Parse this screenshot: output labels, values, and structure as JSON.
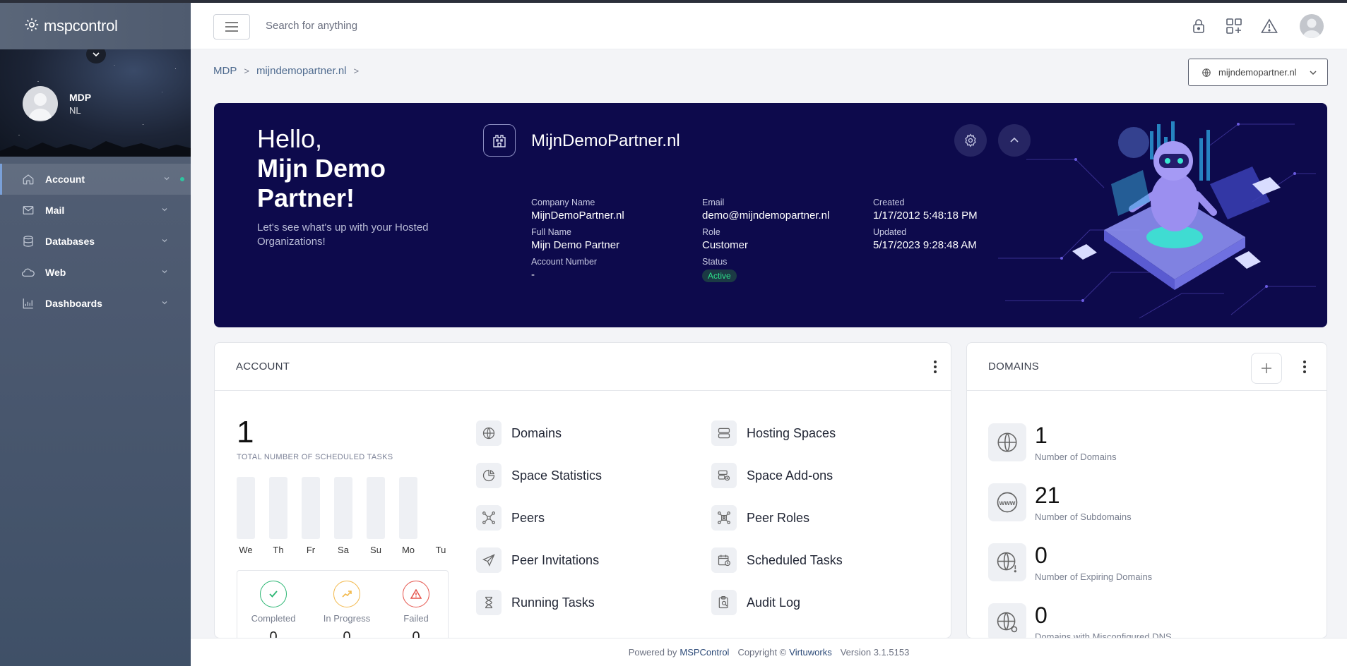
{
  "brand": {
    "name": "mspcontrol",
    "logo_icon": "gear-logo-icon"
  },
  "profile": {
    "name": "MDP",
    "subtitle": "NL"
  },
  "sidebar": {
    "items": [
      {
        "label": "Account",
        "icon": "home-icon",
        "active": true
      },
      {
        "label": "Mail",
        "icon": "mail-icon"
      },
      {
        "label": "Databases",
        "icon": "database-icon"
      },
      {
        "label": "Web",
        "icon": "cloud-icon"
      },
      {
        "label": "Dashboards",
        "icon": "chart-icon"
      }
    ]
  },
  "topbar": {
    "search_placeholder": "Search for anything",
    "icons": [
      "lock-icon",
      "apps-add-icon",
      "warning-icon",
      "user-avatar"
    ]
  },
  "breadcrumb": {
    "items": [
      "MDP",
      "mijndemopartner.nl"
    ]
  },
  "domain_selector": {
    "value": "mijndemopartner.nl"
  },
  "hero": {
    "greeting": "Hello,",
    "name_line1": "Mijn Demo",
    "name_line2": "Partner!",
    "subtitle": "Let's see what's up with your Hosted Organizations!",
    "org_name": "MijnDemoPartner.nl",
    "fields": {
      "company_name": {
        "label": "Company Name",
        "value": "MijnDemoPartner.nl"
      },
      "email": {
        "label": "Email",
        "value": "demo@mijndemopartner.nl"
      },
      "created": {
        "label": "Created",
        "value": "1/17/2012 5:48:18 PM"
      },
      "full_name": {
        "label": "Full Name",
        "value": "Mijn Demo Partner"
      },
      "role": {
        "label": "Role",
        "value": "Customer"
      },
      "updated": {
        "label": "Updated",
        "value": "5/17/2023 9:28:48 AM"
      },
      "account_number": {
        "label": "Account Number",
        "value": "-"
      },
      "status": {
        "label": "Status",
        "value": "Active"
      }
    }
  },
  "account_card": {
    "title": "ACCOUNT",
    "total_scheduled": "1",
    "total_label": "TOTAL NUMBER OF SCHEDULED TASKS",
    "days": [
      "We",
      "Th",
      "Fr",
      "Sa",
      "Su",
      "Mo",
      "Tu"
    ],
    "status": [
      {
        "label": "Completed",
        "value": "0",
        "color": "#2bb673"
      },
      {
        "label": "In Progress",
        "value": "0",
        "color": "#f2b84b"
      },
      {
        "label": "Failed",
        "value": "0",
        "color": "#e5534b"
      }
    ],
    "links": [
      {
        "label": "Domains",
        "icon": "globe-icon"
      },
      {
        "label": "Hosting Spaces",
        "icon": "server-icon"
      },
      {
        "label": "Space Statistics",
        "icon": "pie-chart-icon"
      },
      {
        "label": "Space Add-ons",
        "icon": "addon-icon"
      },
      {
        "label": "Peers",
        "icon": "network-icon"
      },
      {
        "label": "Peer Roles",
        "icon": "peer-roles-icon"
      },
      {
        "label": "Peer Invitations",
        "icon": "send-icon"
      },
      {
        "label": "Scheduled Tasks",
        "icon": "calendar-clock-icon"
      },
      {
        "label": "Running Tasks",
        "icon": "hourglass-icon"
      },
      {
        "label": "Audit Log",
        "icon": "clipboard-search-icon"
      }
    ]
  },
  "domains_card": {
    "title": "DOMAINS",
    "stats": [
      {
        "value": "1",
        "label": "Number of Domains",
        "icon": "globe-icon"
      },
      {
        "value": "21",
        "label": "Number of Subdomains",
        "icon": "www-icon"
      },
      {
        "value": "0",
        "label": "Number of Expiring Domains",
        "icon": "globe-alert-icon"
      },
      {
        "value": "0",
        "label": "Domains with Misconfigured DNS",
        "icon": "globe-gear-icon"
      }
    ]
  },
  "footer": {
    "powered_by": "Powered by",
    "product": "MSPControl",
    "copyright": "Copyright ©",
    "company": "Virtuworks",
    "version": "Version 3.1.5153"
  }
}
